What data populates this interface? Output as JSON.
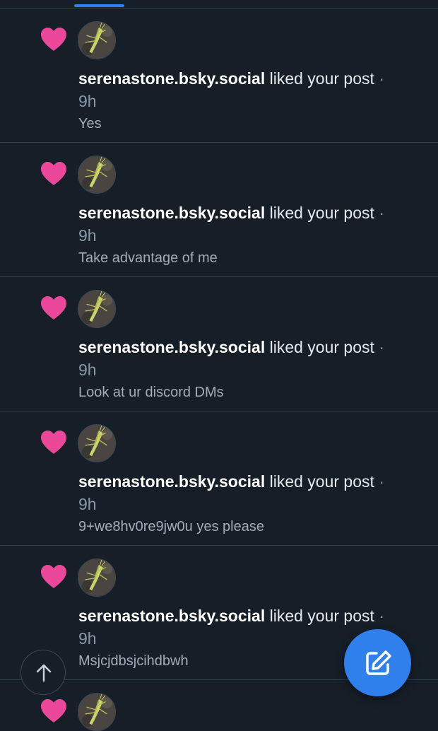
{
  "tabs": {
    "active_indicator_color": "#2f80ed"
  },
  "notifications": [
    {
      "author": "serenastone.bsky.social",
      "action": "liked your post",
      "separator": "·",
      "time": "9h",
      "subject": "Yes",
      "icon": "heart-icon"
    },
    {
      "author": "serenastone.bsky.social",
      "action": "liked your post",
      "separator": "·",
      "time": "9h",
      "subject": "Take advantage of me",
      "icon": "heart-icon"
    },
    {
      "author": "serenastone.bsky.social",
      "action": "liked your post",
      "separator": "·",
      "time": "9h",
      "subject": "Look at ur discord DMs",
      "icon": "heart-icon"
    },
    {
      "author": "serenastone.bsky.social",
      "action": "liked your post",
      "separator": "·",
      "time": "9h",
      "subject": "9+we8hv0re9jw0u yes please",
      "icon": "heart-icon"
    },
    {
      "author": "serenastone.bsky.social",
      "action": "liked your post",
      "separator": "·",
      "time": "9h",
      "subject": "Msjcjdbsjcihdbwh",
      "icon": "heart-icon"
    }
  ],
  "colors": {
    "heart": "#ec4899",
    "background": "#161e27",
    "accent": "#2f80ed"
  },
  "buttons": {
    "scroll_top_icon": "arrow-up-icon",
    "compose_icon": "compose-icon"
  }
}
